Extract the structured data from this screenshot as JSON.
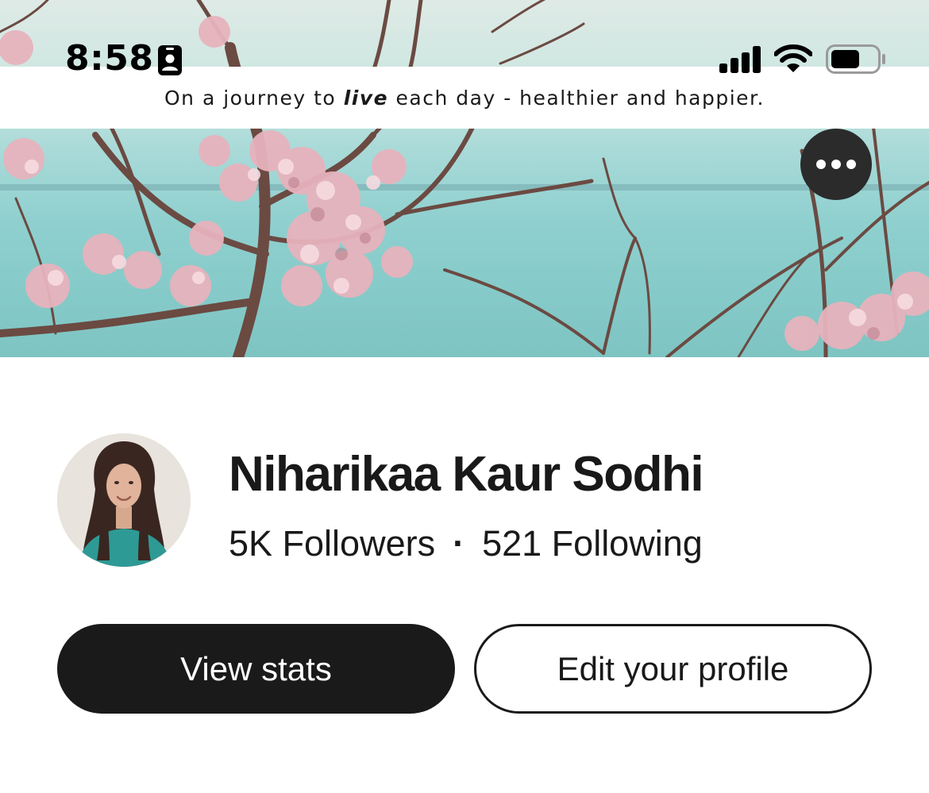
{
  "status_bar": {
    "time": "8:58",
    "icons": [
      "contact-card-icon",
      "cellular-signal-icon",
      "wifi-icon",
      "battery-icon"
    ]
  },
  "cover": {
    "tagline_before": "On a journey to ",
    "tagline_emphasis": "live",
    "tagline_after": " each day - healthier and happier.",
    "more_button_icon": "ellipsis-icon"
  },
  "profile": {
    "name": "Niharikaa Kaur Sodhi",
    "followers_label": "5K Followers",
    "separator": "·",
    "following_label": "521 Following"
  },
  "actions": {
    "view_stats_label": "View stats",
    "edit_profile_label": "Edit your profile"
  },
  "colors": {
    "button_dark": "#1a1a1a",
    "text_primary": "#191919",
    "sea": "#8fd0cf",
    "blossom": "#e7b3bd"
  }
}
